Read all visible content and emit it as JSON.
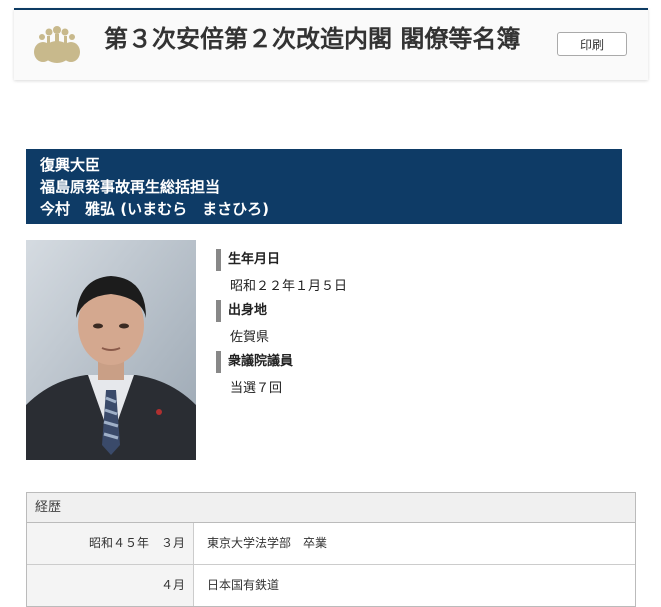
{
  "header": {
    "title": "第３次安倍第２次改造内閣 閣僚等名簿",
    "print_label": "印刷"
  },
  "minister": {
    "post_1": "復興大臣",
    "post_2": "福島原発事故再生総括担当",
    "name": "今村　雅弘 (いまむら　まさひろ)"
  },
  "profile": [
    {
      "label": "生年月日",
      "value": "昭和２２年１月５日"
    },
    {
      "label": "出身地",
      "value": "佐賀県"
    },
    {
      "label": "衆議院議員",
      "value": "当選７回"
    }
  ],
  "history": {
    "heading": "経歴",
    "rows": [
      {
        "date": "昭和４５年　３月",
        "desc": "東京大学法学部　卒業"
      },
      {
        "date": "４月",
        "desc": "日本国有鉄道"
      }
    ]
  },
  "colors": {
    "accent": "#0e3b66",
    "emblem": "#c8b98c"
  },
  "icons": {
    "emblem": "paulownia-crest-icon",
    "photo": "minister-portrait"
  }
}
